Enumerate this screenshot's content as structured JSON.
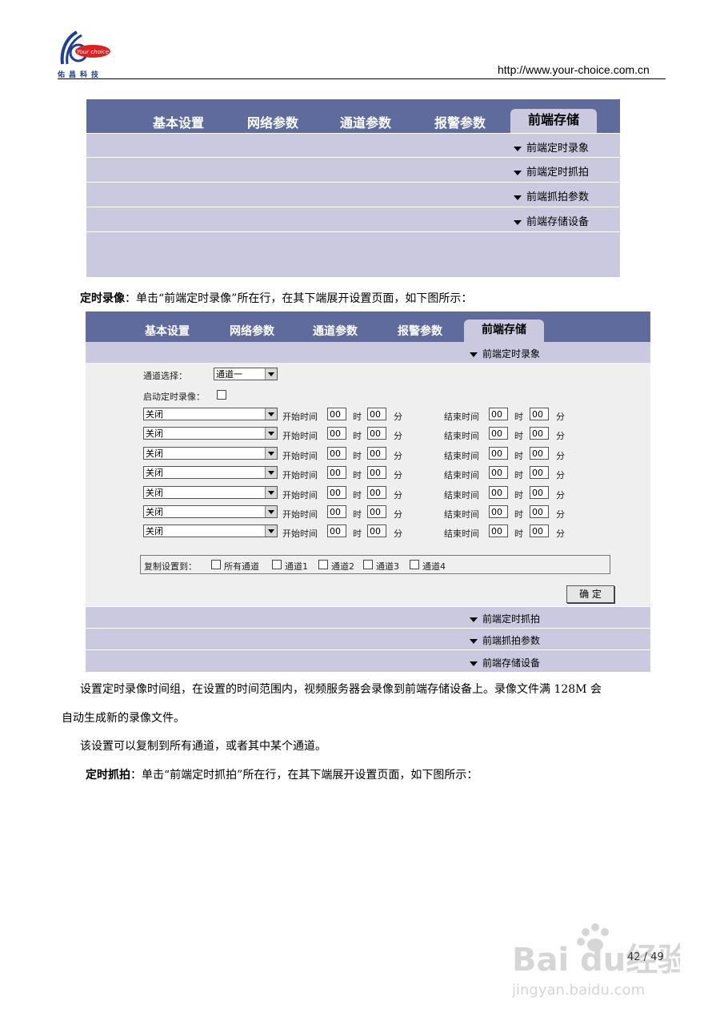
{
  "header": {
    "logo_brand": "Your choice",
    "logo_chinese": "佑昌科技",
    "url": "http://www.your-choice.com.cn"
  },
  "panel1": {
    "tabs": [
      "基本设置",
      "网络参数",
      "通道参数",
      "报警参数",
      "前端存储"
    ],
    "active_tab": "前端存储",
    "rows": [
      "前端定时录象",
      "前端定时抓拍",
      "前端抓拍参数",
      "前端存储设备"
    ]
  },
  "para1": {
    "bold": "定时录像",
    "text": "：单击“前端定时录像”所在行，在其下端展开设置页面，如下图所示："
  },
  "panel2": {
    "tabs": [
      "基本设置",
      "网络参数",
      "通道参数",
      "报警参数",
      "前端存储"
    ],
    "active_tab": "前端存储",
    "expanded_row": "前端定时录象",
    "channel_label": "通道选择：",
    "channel_value": "通道一",
    "enable_label": "启动定时录像：",
    "schedule": [
      {
        "mode": "关闭",
        "start_label": "开始时间",
        "start_h": "00",
        "h": "时",
        "start_m": "00",
        "m": "分",
        "end_label": "结束时间",
        "end_h": "00",
        "end_m": "00"
      },
      {
        "mode": "关闭",
        "start_label": "开始时间",
        "start_h": "00",
        "h": "时",
        "start_m": "00",
        "m": "分",
        "end_label": "结束时间",
        "end_h": "00",
        "end_m": "00"
      },
      {
        "mode": "关闭",
        "start_label": "开始时间",
        "start_h": "00",
        "h": "时",
        "start_m": "00",
        "m": "分",
        "end_label": "结束时间",
        "end_h": "00",
        "end_m": "00"
      },
      {
        "mode": "关闭",
        "start_label": "开始时间",
        "start_h": "00",
        "h": "时",
        "start_m": "00",
        "m": "分",
        "end_label": "结束时间",
        "end_h": "00",
        "end_m": "00"
      },
      {
        "mode": "关闭",
        "start_label": "开始时间",
        "start_h": "00",
        "h": "时",
        "start_m": "00",
        "m": "分",
        "end_label": "结束时间",
        "end_h": "00",
        "end_m": "00"
      },
      {
        "mode": "关闭",
        "start_label": "开始时间",
        "start_h": "00",
        "h": "时",
        "start_m": "00",
        "m": "分",
        "end_label": "结束时间",
        "end_h": "00",
        "end_m": "00"
      },
      {
        "mode": "关闭",
        "start_label": "开始时间",
        "start_h": "00",
        "h": "时",
        "start_m": "00",
        "m": "分",
        "end_label": "结束时间",
        "end_h": "00",
        "end_m": "00"
      }
    ],
    "copy_label": "复制设置到：",
    "copy_targets": [
      "所有通道",
      "通道1",
      "通道2",
      "通道3",
      "通道4"
    ],
    "confirm_label": "确 定",
    "rows_below": [
      "前端定时抓拍",
      "前端抓拍参数",
      "前端存储设备"
    ]
  },
  "para2": "设置定时录像时间组，在设置的时间范围内，视频服务器会录像到前端存储设备上。录像文件满 128M 会",
  "para2b": "自动生成新的录像文件。",
  "para3": "该设置可以复制到所有通道，或者其中某个通道。",
  "para4": {
    "bold": "定时抓拍",
    "text": "：单击“前端定时抓拍”所在行，在其下端展开设置页面，如下图所示："
  },
  "page_number": "42 / 49",
  "watermark": "Baidu经验 jingyan.baidu.com"
}
